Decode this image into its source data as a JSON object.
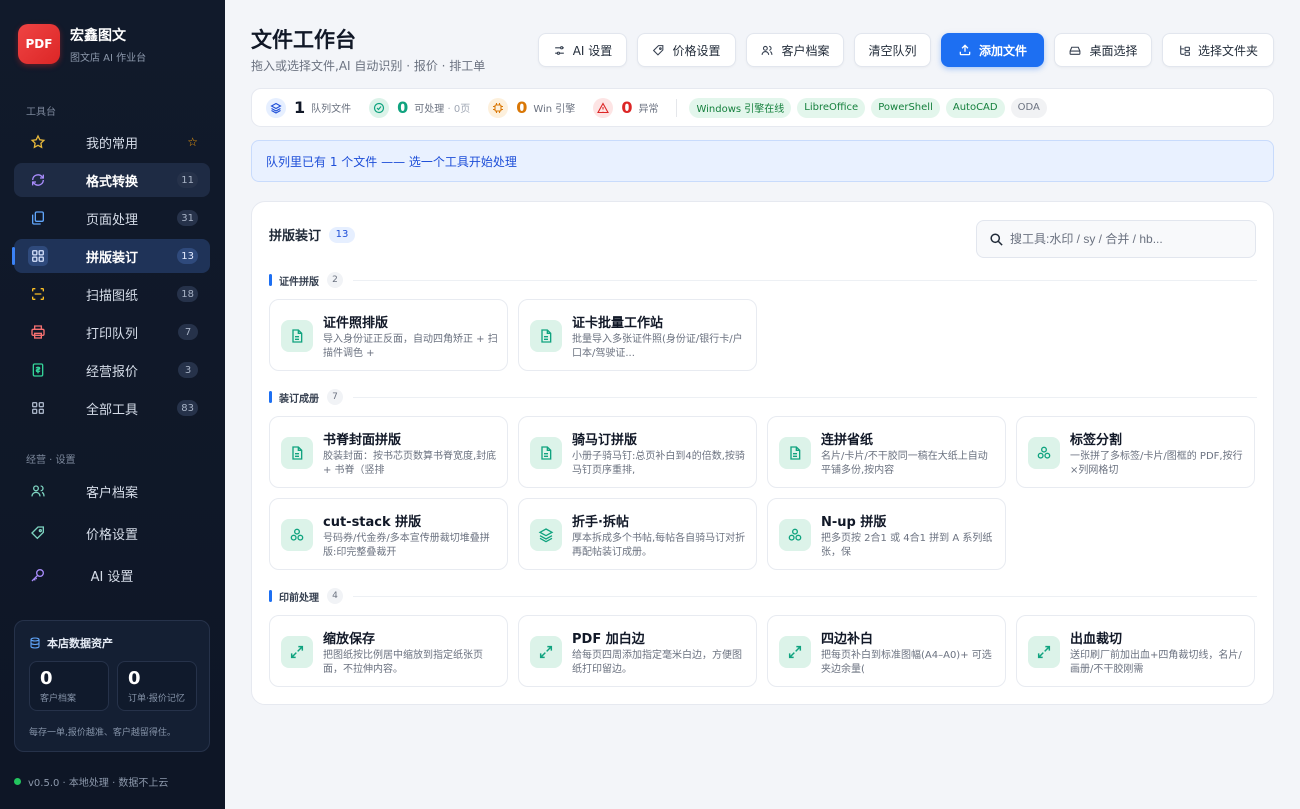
{
  "brand": {
    "logo": "PDF",
    "name": "宏鑫图文",
    "sub": "图文店 AI 作业台"
  },
  "sidebar": {
    "tools_label": "工具台",
    "items": [
      {
        "label": "我的常用",
        "badge": "",
        "icon": "star-icon"
      },
      {
        "label": "格式转换",
        "badge": "11",
        "icon": "convert-icon"
      },
      {
        "label": "页面处理",
        "badge": "31",
        "icon": "pages-icon"
      },
      {
        "label": "拼版装订",
        "badge": "13",
        "icon": "grid-icon"
      },
      {
        "label": "扫描图纸",
        "badge": "18",
        "icon": "scan-icon"
      },
      {
        "label": "打印队列",
        "badge": "7",
        "icon": "printer-icon"
      },
      {
        "label": "经营报价",
        "badge": "3",
        "icon": "quote-icon"
      },
      {
        "label": "全部工具",
        "badge": "83",
        "icon": "apps-icon"
      }
    ],
    "settings_label": "经营 · 设置",
    "settings": [
      {
        "label": "客户档案",
        "icon": "users-icon"
      },
      {
        "label": "价格设置",
        "icon": "tag-icon"
      },
      {
        "label": "AI 设置",
        "icon": "key-icon"
      }
    ],
    "assets": {
      "title": "本店数据资产",
      "customers_num": "0",
      "customers_cap": "客户档案",
      "orders_num": "0",
      "orders_cap": "订单·报价记忆",
      "note": "每存一单,报价越准、客户越留得住。"
    },
    "version": "v0.5.0 · 本地处理 · 数据不上云"
  },
  "header": {
    "title": "文件工作台",
    "subtitle": "拖入或选择文件,AI 自动识别 · 报价 · 排工单",
    "buttons": {
      "ai": "AI 设置",
      "price": "价格设置",
      "customers": "客户档案",
      "clear": "清空队列",
      "add": "添加文件",
      "desktop": "桌面选择",
      "folder": "选择文件夹"
    }
  },
  "status": {
    "queue_num": "1",
    "queue_cap": "队列文件",
    "ok_num": "0",
    "ok_cap": "可处理",
    "ok_pages": "· 0页",
    "win_num": "0",
    "win_cap": "Win 引擎",
    "err_num": "0",
    "err_cap": "异常",
    "chips": [
      "Windows 引擎在线",
      "LibreOffice",
      "PowerShell",
      "AutoCAD",
      "ODA"
    ]
  },
  "banner": "队列里已有 1 个文件 —— 选一个工具开始处理",
  "panel": {
    "title": "拼版装订",
    "count": "13",
    "search_placeholder": "搜工具:水印 / sy / 合并 / hb...",
    "groups": [
      {
        "title": "证件拼版",
        "count": "2",
        "cards": [
          {
            "title": "证件照排版",
            "desc": "导入身份证正反面，自动四角矫正 + 扫描件调色 +"
          },
          {
            "title": "证卡批量工作站",
            "desc": "批量导入多张证件照(身份证/银行卡/户口本/驾驶证..."
          }
        ]
      },
      {
        "title": "装订成册",
        "count": "7",
        "cards": [
          {
            "title": "书脊封面拼版",
            "desc": "胶装封面：按书芯页数算书脊宽度,封底 + 书脊（竖排"
          },
          {
            "title": "骑马订拼版",
            "desc": "小册子骑马钉:总页补白到4的倍数,按骑马钉页序重排,"
          },
          {
            "title": "连拼省纸",
            "desc": "名片/卡片/不干胶同一稿在大纸上自动平铺多份,按内容"
          },
          {
            "title": "标签分割",
            "desc": "一张拼了多标签/卡片/图框的 PDF,按行×列网格切"
          },
          {
            "title": "cut-stack 拼版",
            "desc": "号码券/代金券/多本宣传册裁切堆叠拼版:印完整叠裁开"
          },
          {
            "title": "折手·拆帖",
            "desc": "厚本拆成多个书帖,每帖各自骑马订对折再配帖装订成册。"
          },
          {
            "title": "N-up 拼版",
            "desc": "把多页按 2合1 或 4合1 拼到 A 系列纸张，保"
          }
        ]
      },
      {
        "title": "印前处理",
        "count": "4",
        "cards": [
          {
            "title": "缩放保存",
            "desc": "把图纸按比例居中缩放到指定纸张页面，不拉伸内容。"
          },
          {
            "title": "PDF 加白边",
            "desc": "给每页四周添加指定毫米白边，方便图纸打印留边。"
          },
          {
            "title": "四边补白",
            "desc": "把每页补白到标准图幅(A4–A0)+ 可选夹边余量("
          },
          {
            "title": "出血裁切",
            "desc": "送印刷厂前加出血+四角裁切线，名片/画册/不干胶刚需"
          }
        ]
      }
    ]
  },
  "colors": {
    "accent": "#1d6ff2",
    "sidebar_bg": "#111a2b",
    "card_icon_bg": "#dcf3e9",
    "card_icon_fg": "#10a37f"
  }
}
